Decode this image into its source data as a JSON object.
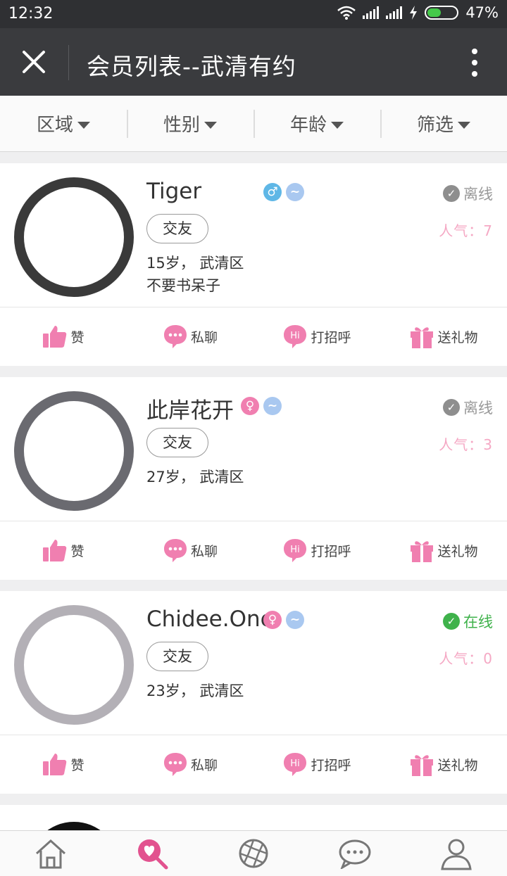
{
  "status_bar": {
    "time": "12:32",
    "battery": "47%",
    "battery_level": 0.47
  },
  "header": {
    "title": "会员列表--武清有约"
  },
  "filters": [
    "区域",
    "性别",
    "年龄",
    "筛选"
  ],
  "members": [
    {
      "name": "Tiger",
      "gender": "male",
      "tag": "交友",
      "age_location": "15岁， 武清区",
      "bio": "不要书呆子",
      "status": "离线",
      "popularity": "人气：7"
    },
    {
      "name": "此岸花开",
      "gender": "female",
      "tag": "交友",
      "age_location": "27岁， 武清区",
      "bio": "",
      "status": "离线",
      "popularity": "人气：3"
    },
    {
      "name": "Chidee.One",
      "gender": "female",
      "tag": "交友",
      "age_location": "23岁， 武清区",
      "bio": "",
      "status": "在线",
      "popularity": "人气：0"
    }
  ],
  "actions": {
    "like": "赞",
    "chat": "私聊",
    "greet": "打招呼",
    "gift": "送礼物"
  },
  "tabs": [
    "home-icon",
    "match-icon",
    "aperture-icon",
    "message-icon",
    "profile-icon"
  ],
  "colors": {
    "accent_pink": "#f07fb0",
    "online_green": "#3fb24b",
    "topbar": "#3a3b3e"
  }
}
